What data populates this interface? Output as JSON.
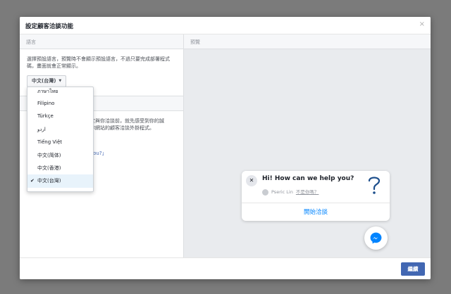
{
  "dialog": {
    "title": "設定顧客洽談功能",
    "close_glyph": "×"
  },
  "language_section": {
    "header": "語言",
    "description": "選擇預設語言，預覽時不會顯示預設語言，不過只要完成部署程式碼，畫面就會正常顯示。",
    "selected_language": "中文(台灣)",
    "caret": "▼"
  },
  "section2": {
    "partial_text": "定與你洽談前，就先感受到你的誠\n你網站的顧客洽談外掛程式。",
    "partial_link": "you?」"
  },
  "dropdown": {
    "items": [
      {
        "label": "ภาษาไทย",
        "selected": false
      },
      {
        "label": "Filipino",
        "selected": false
      },
      {
        "label": "Türkçe",
        "selected": false
      },
      {
        "label": "اردو",
        "selected": false
      },
      {
        "label": "Tiếng Việt",
        "selected": false
      },
      {
        "label": "中文(简体)",
        "selected": false
      },
      {
        "label": "中文(香港)",
        "selected": false
      },
      {
        "label": "中文(台灣)",
        "selected": true
      }
    ],
    "check_glyph": "✔"
  },
  "preview": {
    "header": "預覽",
    "greeting": "Hi! How can we help you?",
    "user_name": "Pseric Lin",
    "not_you": "不是你嗎？",
    "start_chat": "開始洽談",
    "close_glyph": "✕"
  },
  "footer": {
    "continue_label": "繼續"
  },
  "icons": {
    "close": "close-icon",
    "caret": "caret-down-icon",
    "check": "check-icon",
    "question": "question-mark-icon",
    "messenger": "messenger-icon",
    "avatar": "avatar-icon"
  },
  "colors": {
    "primary": "#4267b2",
    "messenger_blue": "#0084ff",
    "preview_bg": "#e9ebee",
    "overlay": "#7b7b7b"
  }
}
